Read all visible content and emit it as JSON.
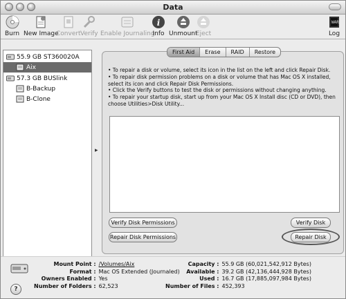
{
  "window": {
    "title": "Data"
  },
  "toolbar": {
    "items": [
      {
        "label": "Burn",
        "icon": "burn-icon",
        "enabled": true
      },
      {
        "label": "New Image",
        "icon": "new-image-icon",
        "enabled": true
      },
      {
        "label": "Convert",
        "icon": "convert-icon",
        "enabled": false
      },
      {
        "label": "Verify",
        "icon": "verify-icon",
        "enabled": false
      },
      {
        "label": "Enable Journaling",
        "icon": "journaling-icon",
        "enabled": false
      },
      {
        "label": "Info",
        "icon": "info-icon",
        "enabled": true
      },
      {
        "label": "Unmount",
        "icon": "unmount-icon",
        "enabled": true
      },
      {
        "label": "Eject",
        "icon": "eject-icon",
        "enabled": false
      },
      {
        "label": "Log",
        "icon": "log-icon",
        "enabled": true
      }
    ]
  },
  "sidebar": {
    "items": [
      {
        "label": "55.9 GB ST360020A",
        "icon": "hard-drive-icon",
        "selected": false
      },
      {
        "label": "Aix",
        "icon": "volume-icon",
        "selected": true
      },
      {
        "label": "57.3 GB BUSlink",
        "icon": "hard-drive-icon",
        "selected": false
      },
      {
        "label": "B-Backup",
        "icon": "volume-icon",
        "selected": false
      },
      {
        "label": "B-Clone",
        "icon": "volume-icon",
        "selected": false
      }
    ]
  },
  "tabs": [
    {
      "label": "First Aid",
      "active": true
    },
    {
      "label": "Erase",
      "active": false
    },
    {
      "label": "RAID",
      "active": false
    },
    {
      "label": "Restore",
      "active": false
    }
  ],
  "first_aid": {
    "instructions": [
      "• To repair a disk or volume, select its icon in the list on the left and click Repair Disk.",
      "• To repair disk permission problems on a disk or volume that has Mac OS X installed, select its icon and click Repair Disk Permissions.",
      "• Click the Verify buttons to test the disk or permissions without changing anything.",
      "• To repair your startup disk, start up from your Mac OS X Install disc (CD or DVD), then choose Utilities>Disk Utility..."
    ],
    "buttons": {
      "verify_permissions": "Verify Disk Permissions",
      "repair_permissions": "Repair Disk Permissions",
      "verify_disk": "Verify Disk",
      "repair_disk": "Repair Disk"
    }
  },
  "info": {
    "left": [
      {
        "key": "Mount Point :",
        "value": "/Volumes/Aix"
      },
      {
        "key": "Format :",
        "value": "Mac OS Extended (Journaled)"
      },
      {
        "key": "Owners Enabled :",
        "value": "Yes"
      },
      {
        "key": "Number of Folders :",
        "value": "62,523"
      }
    ],
    "right": [
      {
        "key": "Capacity :",
        "value": "55.9 GB (60,021,542,912 Bytes)"
      },
      {
        "key": "Available :",
        "value": "39.2 GB (42,136,444,928 Bytes)"
      },
      {
        "key": "Used :",
        "value": "16.7 GB (17,885,097,984 Bytes)"
      },
      {
        "key": "Number of Files :",
        "value": "452,393"
      }
    ]
  },
  "help_button": "?"
}
